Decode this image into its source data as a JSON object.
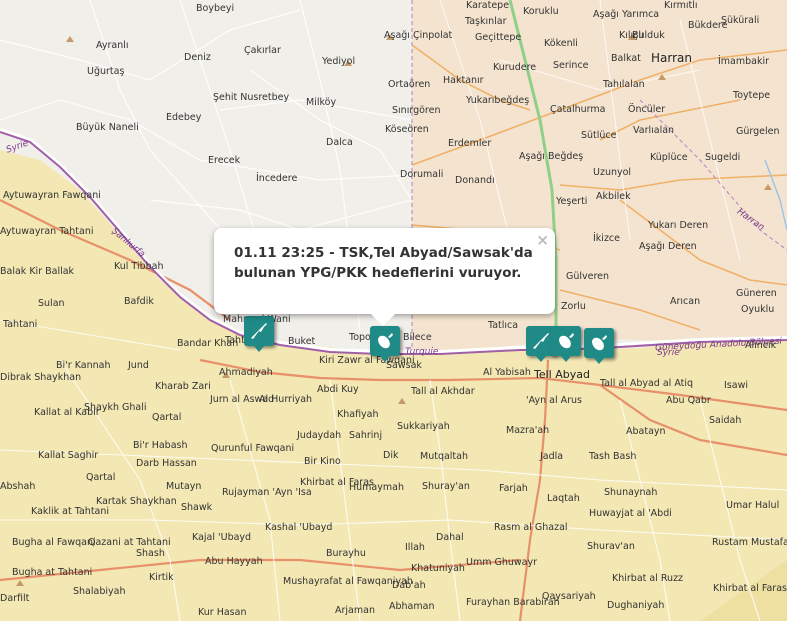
{
  "popup": {
    "text": "01.11 23:25 - TSK,Tel Abyad/Sawsak'da bulunan YPG/PKK hedeflerini vuruyor.",
    "close_symbol": "×"
  },
  "markers": [
    {
      "type": "rifle",
      "icon": "rifle-icon"
    },
    {
      "type": "bomb",
      "icon": "bomb-icon"
    },
    {
      "type": "rifle",
      "icon": "rifle-icon"
    },
    {
      "type": "bomb",
      "icon": "bomb-icon"
    },
    {
      "type": "bomb",
      "icon": "bomb-icon"
    }
  ],
  "border_labels": [
    "Syrie",
    "Şanlıurfa",
    "Turquie",
    "Güneydoğu Anadolu Bölgesi",
    "Syrie",
    "Harran"
  ],
  "colors": {
    "turkey_land": "#f1efea",
    "harran_district": "#f4e4cf",
    "syria_land": "#f3e7b3",
    "border": "#a060a8",
    "marker": "#1f8a86"
  },
  "places": [
    "Boybeyi",
    "Ayranlı",
    "Uğurtaş",
    "Deniz",
    "Çakırlar",
    "Yediyol",
    "Şehit Nusretbey",
    "Milköy",
    "Edebey",
    "Büyük Naneli",
    "Erecek",
    "İncedere",
    "Dalca",
    "Aşağı Çinpolat",
    "Ortaören",
    "Sınırgören",
    "Köseören",
    "Haktanır",
    "Erdemler",
    "Dorumali",
    "Donandı",
    "Karatepe",
    "Taşkınlar",
    "Geçittepe",
    "Koruklu",
    "Kökenli",
    "Kurudere",
    "Serince",
    "Yukarıbeğdeş",
    "Aşağı Beğdeş",
    "Çatalhurma",
    "Sütlüce",
    "Uzunyol",
    "Akbilek",
    "Yeşerti",
    "İkizce",
    "Gülveren",
    "Zorlu",
    "Tatlıca",
    "Bilece",
    "Aşağı Yarımca",
    "Kırmıtlı",
    "Kılıçlı",
    "Bulduk",
    "Bükdere",
    "Şükürali",
    "Harran",
    "Balkat",
    "Tahılalan",
    "İmambakir",
    "Toytepe",
    "Öncüler",
    "Varlıalan",
    "Gürgelen",
    "Küplüce",
    "Sugeldi",
    "Yukarı Deren",
    "Aşağı Deren",
    "Arıcan",
    "Güneren",
    "Oyuklu",
    "Alıncık",
    "Aytuwayran Fawqani",
    "Aytuwayran Tahtani",
    "Kul Tibbah",
    "Sulan",
    "Tahtani",
    "Bafdik",
    "Bandar Khan",
    "Mahmud Wani",
    "Tahtani",
    "Buket",
    "Topo",
    "Kiri Zawr al Fawqani",
    "Sawsak",
    "Bi'r Kannah",
    "Jund",
    "Ahmadiyah",
    "Kharab Zari",
    "Abdi Kuy",
    "Tall al Akhdar",
    "Al Yabisah",
    "Tell Abyad",
    "Tall al Abyad al Atiq",
    "Isawi",
    "Shaykh Ghali",
    "Qartal",
    "Jurn al Aswad",
    "Al Hurriyah",
    "Khafiyah",
    "Sukkariyah",
    "'Ayn al Arus",
    "Abu Qabr",
    "Saidah",
    "Bi'r Habash",
    "Qurunful Fawqani",
    "Judaydah",
    "Sahrinj",
    "Mazra'ah",
    "Abatayn",
    "Kallat Saghir",
    "Darb Hassan",
    "Bir Kino",
    "Dik",
    "Mutqaltah",
    "Jadla",
    "Tash Bash",
    "Qartal",
    "Mutayn",
    "Khirbat al Faras",
    "Humaymah",
    "Shuray'an",
    "Farjah",
    "Laqtah",
    "Shunaynah",
    "Kartak Shaykhan",
    "Shawk",
    "Rujayman 'Ayn 'Isa",
    "Kashal 'Ubayd",
    "Huwayjat al 'Abdi",
    "Umar Halul",
    "Kaklik at Tahtani",
    "Bugha al Fawqani",
    "Qazani at Tahtani",
    "Shash",
    "Kajal 'Ubayd",
    "Burayhu",
    "Illah",
    "Dahal",
    "Rasm al Ghazal",
    "Shurav'an",
    "Rustam Mustafa",
    "Abu Hayyah",
    "Mushayrafat al Fawqaniyah",
    "Khatuniyah",
    "Umm Ghuwayr",
    "Khirbat al Ruzz",
    "Bugha at Tahtani",
    "Kirtik",
    "Shalabiyah",
    "Dab'ah",
    "Furayhan Barabirah",
    "Qaysariyah",
    "Dughaniyah",
    "Khirbat al Faras",
    "Darfilt",
    "Kur Hasan",
    "Arjaman",
    "Abhaman",
    "Kallat al Kabir",
    "Dibrak Shaykhan",
    "Abshah",
    "Balak Kir Ballak",
    "Turquie",
    "Akçakale"
  ]
}
